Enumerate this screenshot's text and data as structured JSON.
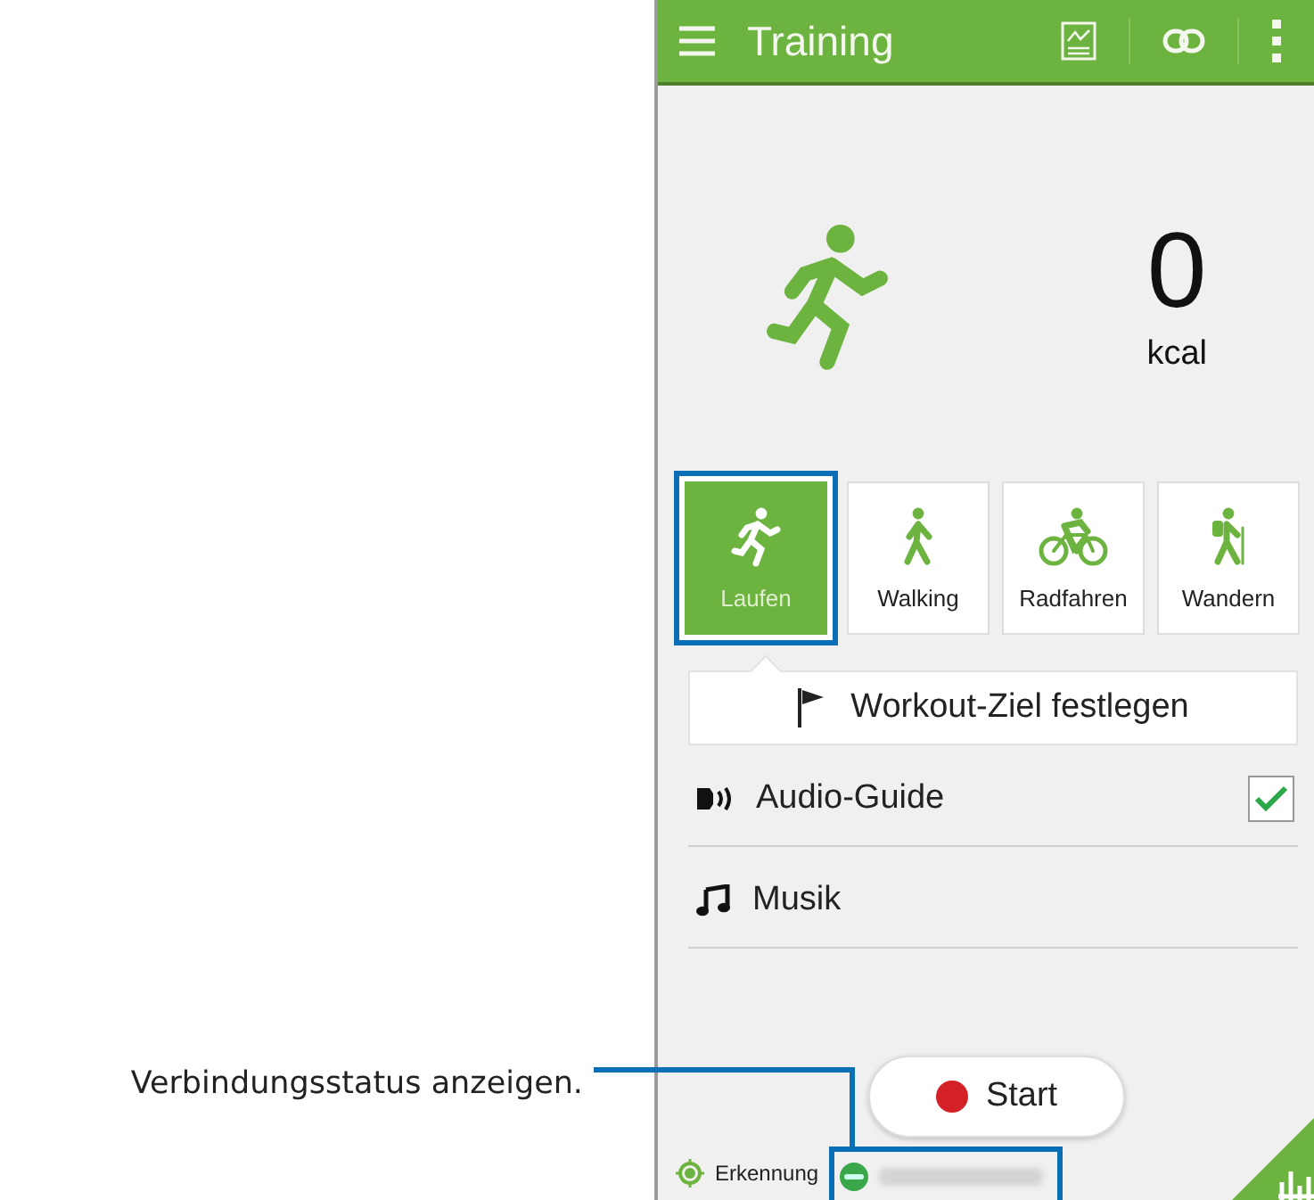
{
  "header": {
    "title": "Training"
  },
  "calories": {
    "value": "0",
    "unit": "kcal"
  },
  "activities": [
    {
      "label": "Laufen",
      "kind": "run",
      "selected": true
    },
    {
      "label": "Walking",
      "kind": "walk",
      "selected": false
    },
    {
      "label": "Radfahren",
      "kind": "bike",
      "selected": false
    },
    {
      "label": "Wandern",
      "kind": "hike",
      "selected": false
    }
  ],
  "goal_button": "Workout-Ziel festlegen",
  "options": [
    {
      "label": "Audio-Guide",
      "kind": "audio",
      "checked": true
    },
    {
      "label": "Musik",
      "kind": "music"
    }
  ],
  "start_button": "Start",
  "status_bar": {
    "detection": "Erkennung"
  },
  "callout": "Verbindungsstatus anzeigen."
}
